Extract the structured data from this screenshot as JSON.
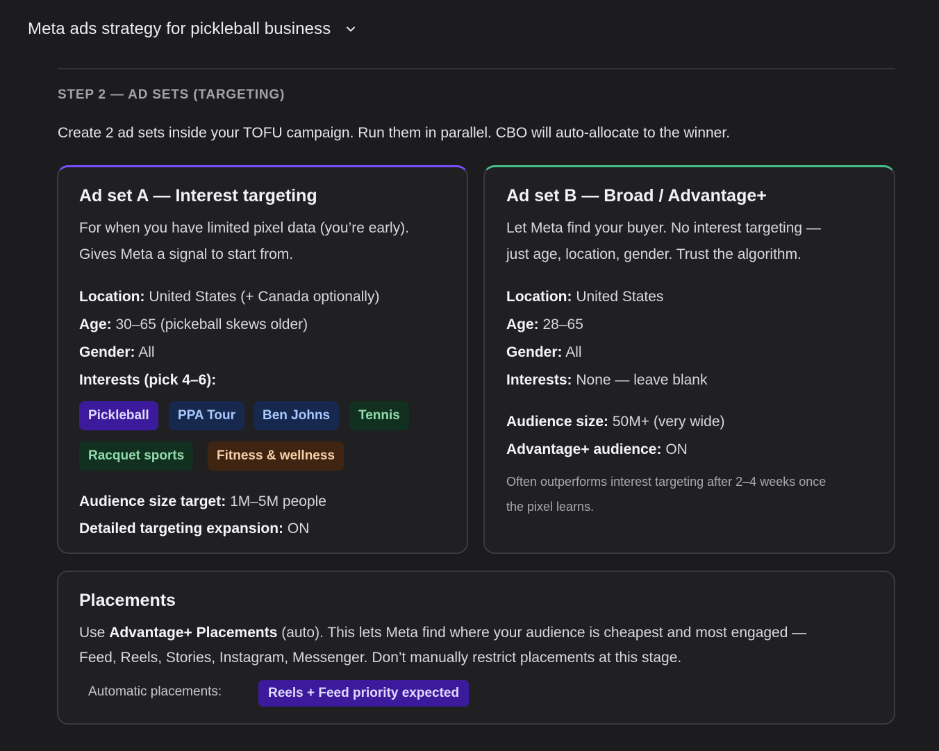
{
  "header": {
    "title": "Meta ads strategy for pickleball business",
    "chevron_icon": "chevron-down-icon"
  },
  "step": {
    "label": "STEP 2 — AD SETS (TARGETING)",
    "intro": "Create 2 ad sets inside your TOFU campaign. Run them in parallel. CBO will auto-allocate to the winner."
  },
  "ad_set_a": {
    "title": "Ad set A — Interest targeting",
    "desc_line1": "For when you have limited pixel data (you’re early).",
    "desc_line2": "Gives Meta a signal to start from.",
    "location_label": "Location:",
    "location_value": " United States (+ Canada optionally)",
    "age_label": "Age:",
    "age_value": " 30–65 (pickeball skews older)",
    "gender_label": "Gender:",
    "gender_value": " All",
    "interests_label": "Interests (pick 4–6):",
    "interests": [
      "Pickleball",
      "PPA Tour",
      "Ben Johns",
      "Tennis",
      "Racquet sports",
      "Fitness & wellness"
    ],
    "audience_label": "Audience size target:",
    "audience_value": " 1M–5M people",
    "expansion_label": "Detailed targeting expansion:",
    "expansion_value": " ON",
    "accent": "#7c4dff"
  },
  "ad_set_b": {
    "title": "Ad set B — Broad / Advantage+",
    "desc_line1": "Let Meta find your buyer. No interest targeting —",
    "desc_line2": "just age, location, gender. Trust the algorithm.",
    "location_label": "Location:",
    "location_value": " United States",
    "age_label": "Age:",
    "age_value": " 28–65",
    "gender_label": "Gender:",
    "gender_value": " All",
    "interests_label": "Interests:",
    "interests_value": " None — leave blank",
    "audience_label": "Audience size:",
    "audience_value": " 50M+ (very wide)",
    "advantage_label": "Advantage+ audience:",
    "advantage_value": " ON",
    "note_line1": "Often outperforms interest targeting after 2–4 weeks once",
    "note_line2": "the pixel learns.",
    "accent": "#43c08a"
  },
  "placements": {
    "title": "Placements",
    "text_pre": "Use ",
    "text_bold": "Advantage+ Placements",
    "text_line1_post": " (auto). This lets Meta find where your audience is cheapest and most engaged —",
    "text_line2": "Feed, Reels, Stories, Instagram, Messenger. Don’t manually restrict placements at this stage.",
    "auto_label": "Automatic placements:",
    "badge": "Reels + Feed priority expected"
  },
  "colors": {
    "background": "#1c1c1e",
    "card": "#202022",
    "purple_chip": "#3b1b9c",
    "blue_chip": "#16284d",
    "green_chip": "#12301f",
    "orange_chip": "#3f2411"
  }
}
